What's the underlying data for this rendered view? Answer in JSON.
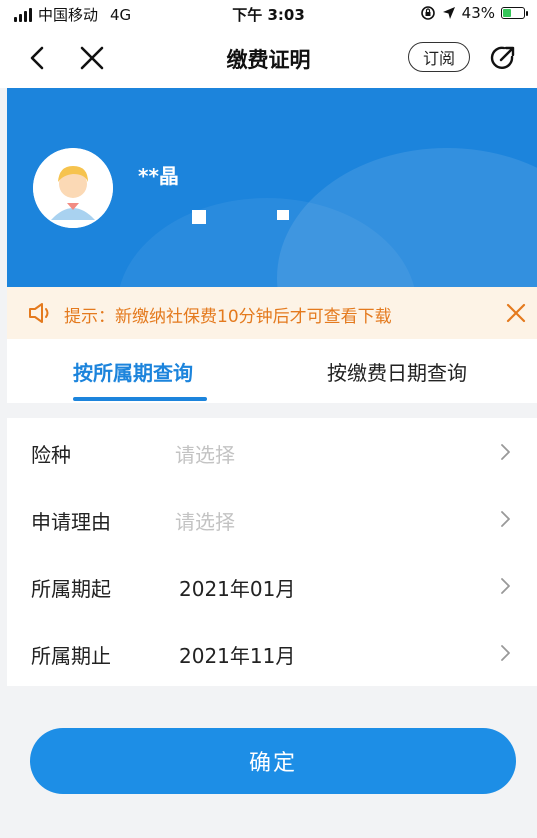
{
  "status_bar": {
    "carrier": "中国移动",
    "network": "4G",
    "time": "下午 3:03",
    "battery": "43%",
    "battery_level": 0.43,
    "icons": [
      "signal-icon",
      "orientation-lock-icon",
      "location-icon",
      "battery-charging-icon"
    ]
  },
  "nav": {
    "title": "缴费证明",
    "subscribe_label": "订阅",
    "icons": [
      "back-icon",
      "close-icon",
      "share-icon"
    ]
  },
  "banner": {
    "user_name": "**晶"
  },
  "notice": {
    "text": "提示：新缴纳社保费10分钟后才可查看下载",
    "icons": [
      "speaker-icon",
      "close-icon"
    ],
    "text_color": "#e47a1e",
    "background": "#fdf3e6"
  },
  "tabs": [
    {
      "label": "按所属期查询",
      "active": true
    },
    {
      "label": "按缴费日期查询",
      "active": false
    }
  ],
  "form": {
    "rows": [
      {
        "label": "险种",
        "value": "请选择",
        "is_placeholder": true
      },
      {
        "label": "申请理由",
        "value": "请选择",
        "is_placeholder": true
      },
      {
        "label": "所属期起",
        "value": "2021年01月",
        "is_placeholder": false
      },
      {
        "label": "所属期止",
        "value": "2021年11月",
        "is_placeholder": false
      }
    ]
  },
  "confirm_label": "确定",
  "colors": {
    "accent": "#1c84dc",
    "button": "#1d8ee6",
    "page_bg": "#f2f3f5"
  }
}
